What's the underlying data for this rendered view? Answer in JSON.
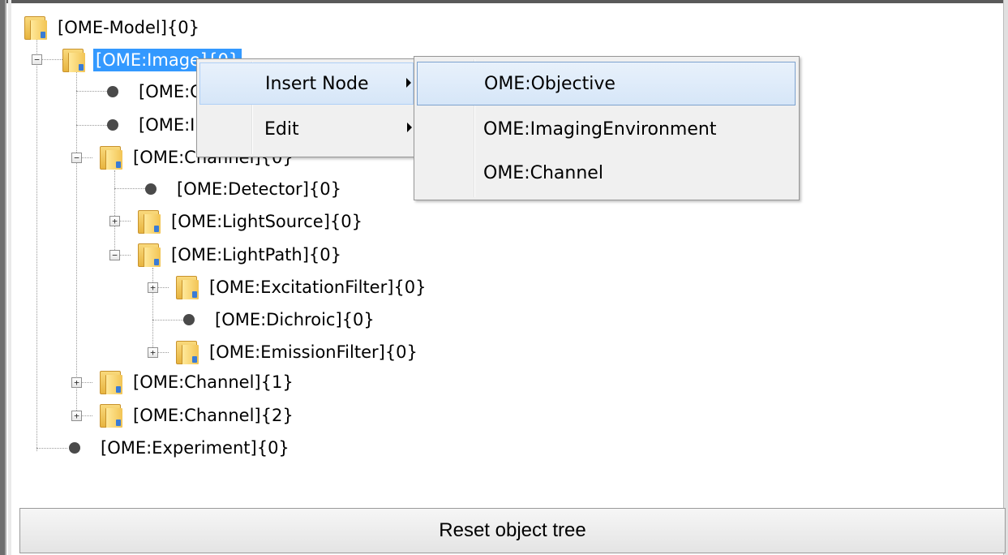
{
  "tree": {
    "nodes": [
      {
        "label": "[OME-Model]{0}"
      },
      {
        "label": "[OME:Image]{0}"
      },
      {
        "label": "[OME:Objective]{0}"
      },
      {
        "label": "[OME:ImagingEnvironment]{0}"
      },
      {
        "label": "[OME:Channel]{0}"
      },
      {
        "label": "[OME:Detector]{0}"
      },
      {
        "label": "[OME:LightSource]{0}"
      },
      {
        "label": "[OME:LightPath]{0}"
      },
      {
        "label": "[OME:ExcitationFilter]{0}"
      },
      {
        "label": "[OME:Dichroic]{0}"
      },
      {
        "label": "[OME:EmissionFilter]{0}"
      },
      {
        "label": "[OME:Channel]{1}"
      },
      {
        "label": "[OME:Channel]{2}"
      },
      {
        "label": "[OME:Experiment]{0}"
      }
    ]
  },
  "context_menu": {
    "items": [
      {
        "label": "Insert Node"
      },
      {
        "label": "Edit"
      }
    ]
  },
  "submenu": {
    "items": [
      {
        "label": "OME:Objective"
      },
      {
        "label": "OME:ImagingEnvironment"
      },
      {
        "label": "OME:Channel"
      }
    ]
  },
  "reset_button": {
    "label": "Reset object tree"
  }
}
